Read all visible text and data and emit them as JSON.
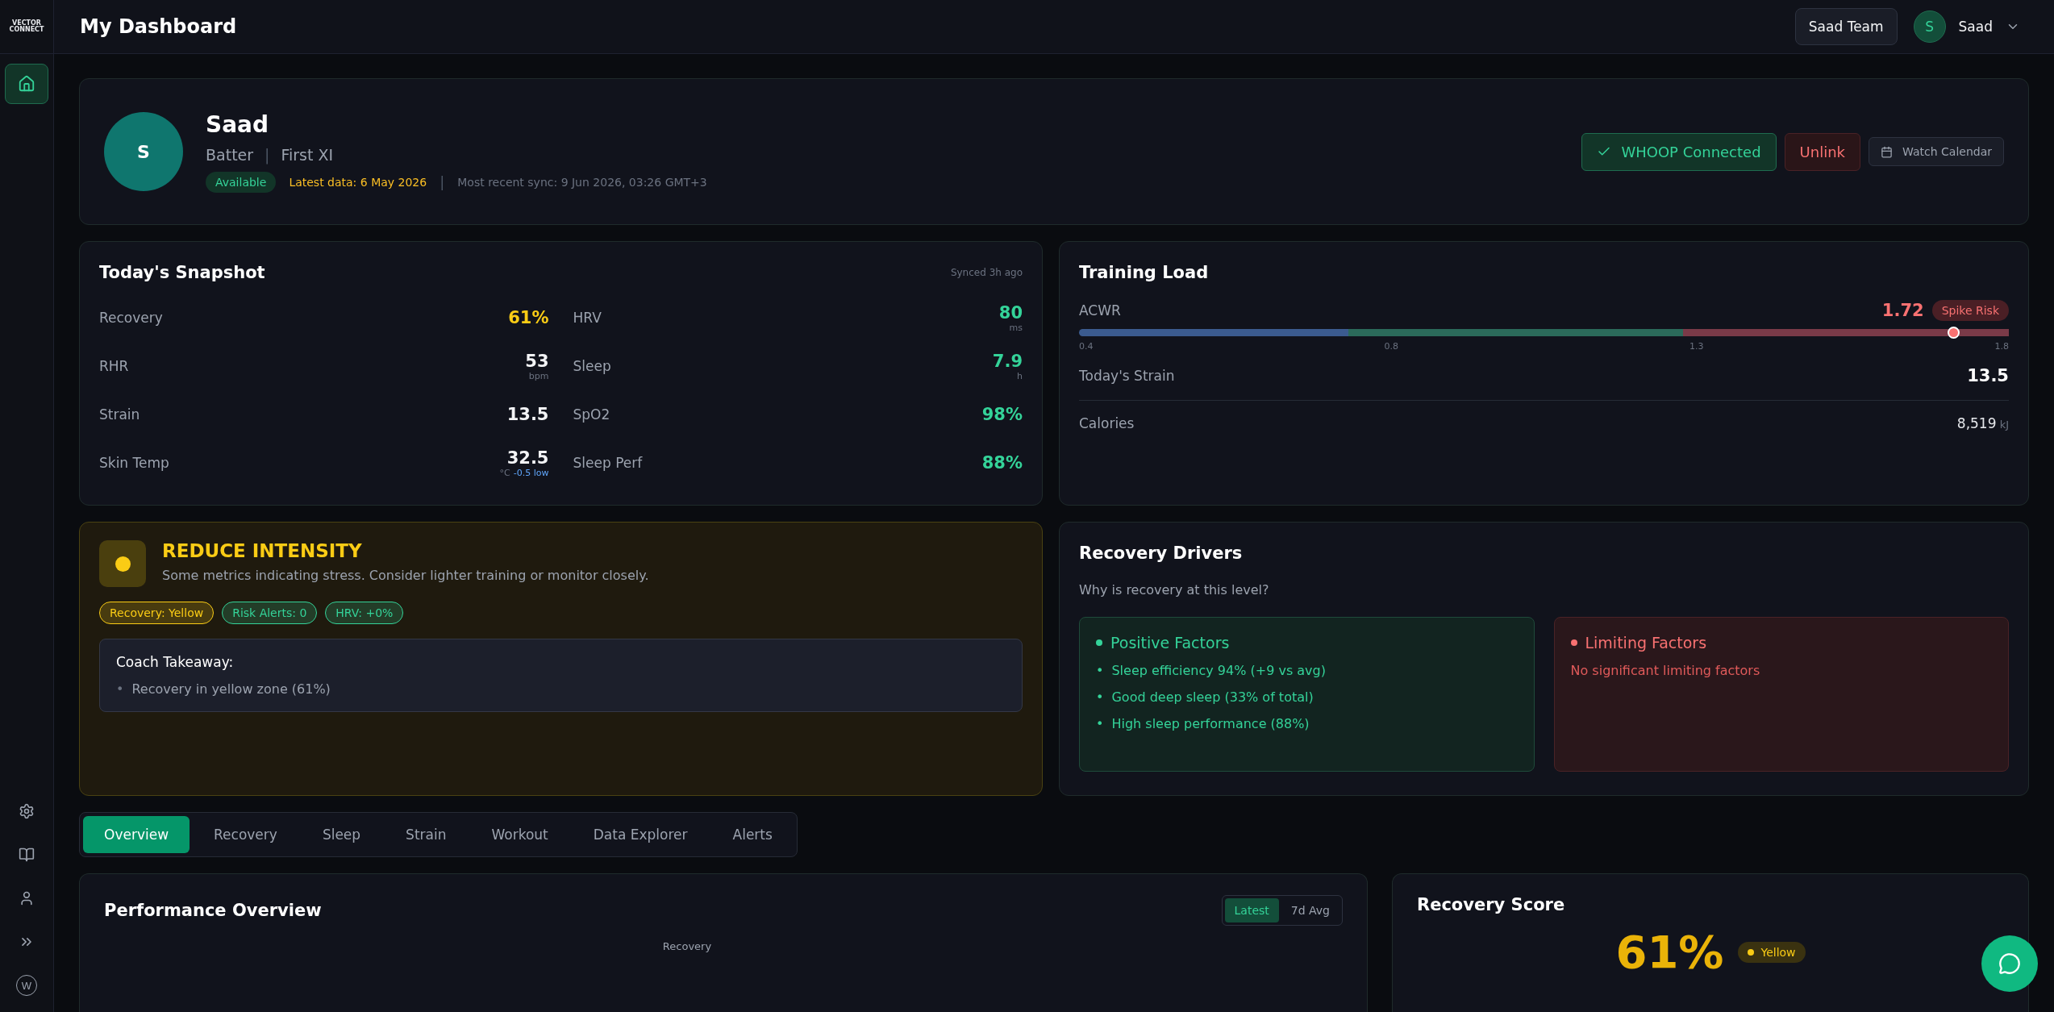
{
  "logo": {
    "line_1": "VECTOR",
    "line_2": "CONNECT"
  },
  "sidebar": {
    "items": [
      {
        "selected": true
      }
    ],
    "footer_badge": "W"
  },
  "header": {
    "title": "My Dashboard",
    "team_button": "Saad Team",
    "user": {
      "initial": "S",
      "name": "Saad"
    }
  },
  "profile": {
    "initial": "S",
    "name": "Saad",
    "role": "Batter",
    "separator": "|",
    "squad": "First XI",
    "status": "Available",
    "latest_data": "Latest data: 6 May 2026",
    "sync": "Most recent sync: 9 Jun 2026, 03:26 GMT+3",
    "connected": "WHOOP Connected",
    "unlink": "Unlink",
    "calendar": "Watch Calendar"
  },
  "snapshot": {
    "title": "Today's Snapshot",
    "synced": "Synced 3h ago",
    "metrics": [
      {
        "label": "Recovery",
        "value": "61%",
        "color": "#facc15"
      },
      {
        "label": "HRV",
        "value": "80",
        "unit": "ms",
        "color": "#34d399"
      },
      {
        "label": "RHR",
        "value": "53",
        "unit": "bpm",
        "color": "#f3f4f6"
      },
      {
        "label": "Sleep",
        "value": "7.9",
        "unit": "h",
        "color": "#34d399"
      },
      {
        "label": "Strain",
        "value": "13.5",
        "color": "#f3f4f6"
      },
      {
        "label": "SpO2",
        "value": "98%",
        "color": "#34d399"
      },
      {
        "label": "Skin Temp",
        "value": "32.5",
        "unit": "°C",
        "note": "-0.5 low",
        "color": "#f3f4f6"
      },
      {
        "label": "Sleep Perf",
        "value": "88%",
        "color": "#34d399"
      }
    ]
  },
  "training_load": {
    "title": "Training Load",
    "acwr": {
      "label": "ACWR",
      "value": "1.72",
      "badge": "Spike Risk",
      "level": 0.94,
      "ticks": [
        "0.4",
        "0.8",
        "1.3",
        "1.8"
      ]
    },
    "rows": [
      {
        "label": "Today's Strain",
        "value": "13.5"
      },
      {
        "label": "Calories",
        "value": "8,519",
        "unit": "kJ"
      }
    ]
  },
  "alert": {
    "title": "REDUCE INTENSITY",
    "message": "Some metrics indicating stress. Consider lighter training or monitor closely.",
    "tags": [
      {
        "text": "Recovery: Yellow",
        "color": "#facc15"
      },
      {
        "text": "Risk Alerts: 0",
        "color": "#34d399"
      },
      {
        "text": "HRV: +0%",
        "color": "#34d399"
      }
    ],
    "takeaway_title": "Coach Takeaway:",
    "bullet": "•",
    "takeaways": [
      "Recovery in yellow zone (61%)"
    ]
  },
  "recovery_drivers": {
    "title": "Recovery Drivers",
    "subtitle": "Why is recovery at this level?",
    "positive": {
      "title": "Positive Factors",
      "bullet": "•",
      "items": [
        "Sleep efficiency 94% (+9 vs avg)",
        "Good deep sleep (33% of total)",
        "High sleep performance (88%)"
      ]
    },
    "limiting": {
      "title": "Limiting Factors",
      "empty": "No significant limiting factors"
    }
  },
  "tabs": [
    {
      "label": "Overview",
      "selected": true
    },
    {
      "label": "Recovery",
      "selected": false
    },
    {
      "label": "Sleep",
      "selected": false
    },
    {
      "label": "Strain",
      "selected": false
    },
    {
      "label": "Workout",
      "selected": false
    },
    {
      "label": "Data Explorer",
      "selected": false
    },
    {
      "label": "Alerts",
      "selected": false
    }
  ],
  "performance": {
    "title": "Performance Overview",
    "toggle": [
      {
        "label": "Latest",
        "selected": true
      },
      {
        "label": "7d Avg",
        "selected": false
      }
    ],
    "chart_label": "Recovery"
  },
  "recovery_score": {
    "title": "Recovery Score",
    "value": "61%",
    "badge": "Yellow"
  }
}
